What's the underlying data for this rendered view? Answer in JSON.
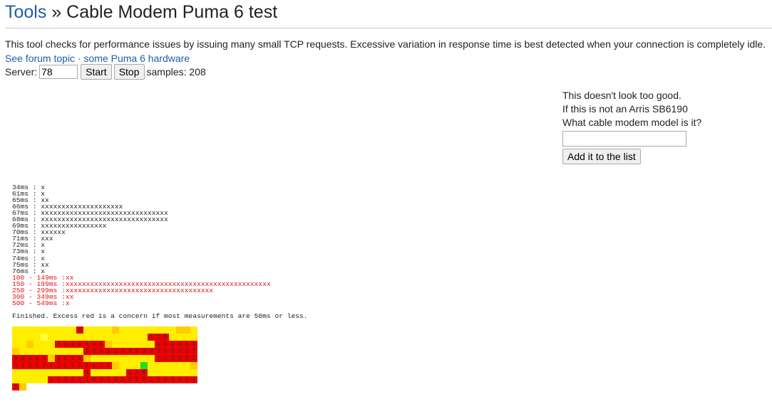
{
  "header": {
    "breadcrumb_link": "Tools",
    "separator": " » ",
    "title": "Cable Modem Puma 6 test"
  },
  "intro": {
    "description": "This tool checks for performance issues by issuing many small TCP requests. Excessive variation in response time is best detected when your connection is completely idle.",
    "link_forum": "See forum topic",
    "link_sep": " · ",
    "link_hardware": "some Puma 6 hardware"
  },
  "controls": {
    "server_label": "Server:",
    "server_value": "78",
    "start_label": "Start",
    "stop_label": "Stop",
    "samples_text": "samples: 208"
  },
  "side": {
    "line1": "This doesn't look too good.",
    "line2": "If this is not an Arris SB6190",
    "line3": "What cable modem model is it?",
    "model_value": "",
    "add_label": "Add it to the list"
  },
  "histogram": [
    {
      "label": "34ms : ",
      "count": 1,
      "bad": false
    },
    {
      "label": "61ms : ",
      "count": 1,
      "bad": false
    },
    {
      "label": "65ms : ",
      "count": 2,
      "bad": false
    },
    {
      "label": "66ms : ",
      "count": 20,
      "bad": false
    },
    {
      "label": "67ms : ",
      "count": 31,
      "bad": false
    },
    {
      "label": "68ms : ",
      "count": 31,
      "bad": false
    },
    {
      "label": "69ms : ",
      "count": 16,
      "bad": false
    },
    {
      "label": "70ms : ",
      "count": 6,
      "bad": false
    },
    {
      "label": "71ms : ",
      "count": 3,
      "bad": false
    },
    {
      "label": "72ms : ",
      "count": 1,
      "bad": false
    },
    {
      "label": "73ms : ",
      "count": 1,
      "bad": false
    },
    {
      "label": "74ms : ",
      "count": 1,
      "bad": false
    },
    {
      "label": "75ms : ",
      "count": 2,
      "bad": false
    },
    {
      "label": "76ms : ",
      "count": 1,
      "bad": false
    },
    {
      "label": "100 - 149ms :",
      "count": 2,
      "bad": true
    },
    {
      "label": "150 - 199ms :",
      "count": 50,
      "bad": true
    },
    {
      "label": "250 - 299ms :",
      "count": 36,
      "bad": true
    },
    {
      "label": "300 - 349ms :",
      "count": 2,
      "bad": true
    },
    {
      "label": "500 - 549ms :",
      "count": 1,
      "bad": true
    }
  ],
  "finished_text": "Finished. Excess red is a concern if most measurements are 50ms or less.",
  "grid": {
    "legend": {
      "Y": "#ffee00",
      "L": "#ffff33",
      "O": "#ffcc00",
      "G": "#22dd22",
      "red": "#ee0000"
    },
    "rows": [
      "YYYYYYYYY4YYYYOYYYYYYYYOOY",
      "YYYYLYYYYYYYYYYYYYY110YYYY",
      "YYOYYY1111111OYYYYYY111111",
      "OYYYYYYYYY3331133333333333",
      "33311O1111OYYYYYYYYY113331",
      "11111111111111OYYYGYYYYYYO",
      "YYYYYYYYYY4YYYYY110YYYYYYY",
      "YYYYY133311633333333333311",
      "1O"
    ]
  }
}
